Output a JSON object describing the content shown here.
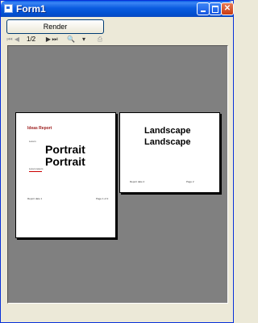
{
  "window": {
    "title": "Form1",
    "minimize_glyph": "",
    "maximize_glyph": "",
    "close_glyph": "✕"
  },
  "actions": {
    "render_label": "Render"
  },
  "toolbar": {
    "first_glyph": "⏮",
    "prev_glyph": "◀",
    "page_indicator": "1/2",
    "next_glyph": "▶",
    "last_glyph": "⏭",
    "zoom_glyph": "🔍",
    "zoom_dropdown_glyph": "▾",
    "print_glyph": "⎙"
  },
  "preview": {
    "pages": [
      {
        "header": "Ideas Report",
        "text_lines": [
          "Portrait",
          "Portrait"
        ],
        "small_left_top": "Lorem",
        "small_left_mid": "Lorem ipsum",
        "footer_left": "Report date 1",
        "footer_right": "Page 1 of 2"
      },
      {
        "text_lines": [
          "Landscape",
          "Landscape"
        ],
        "footer_left": "Report date 2",
        "footer_right": "Page 2"
      }
    ]
  },
  "colors": {
    "titlebar": "#0b5ce0",
    "preview_background": "#808080",
    "window_face": "#ece9d8",
    "header_red": "#9b1a1a"
  }
}
